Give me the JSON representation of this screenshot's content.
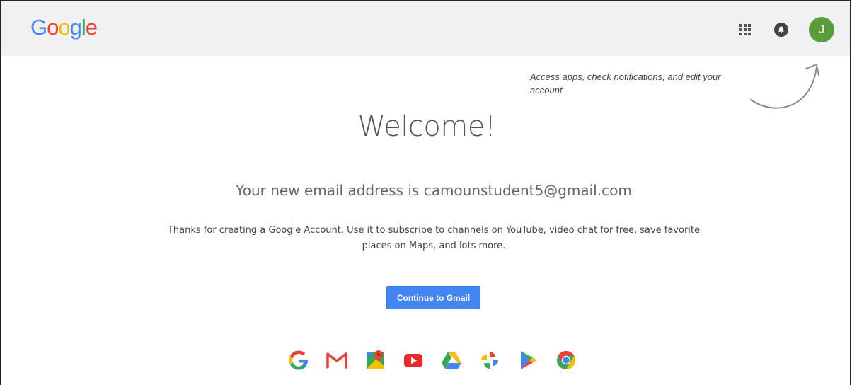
{
  "header": {
    "logo_text": [
      "G",
      "o",
      "o",
      "g",
      "l",
      "e"
    ],
    "avatar_initial": "J"
  },
  "hint": {
    "text": "Access apps, check notifications, and edit your account"
  },
  "main": {
    "welcome": "Welcome!",
    "email_line": "Your new email address is camounstudent5@gmail.com",
    "description": "Thanks for creating a Google Account. Use it to subscribe to channels on YouTube, video chat for free, save favorite places on Maps, and lots more.",
    "continue_button": "Continue to Gmail"
  },
  "apps": [
    {
      "icon": "google-icon"
    },
    {
      "icon": "gmail-icon"
    },
    {
      "icon": "maps-icon"
    },
    {
      "icon": "youtube-icon"
    },
    {
      "icon": "drive-icon"
    },
    {
      "icon": "photos-icon"
    },
    {
      "icon": "play-store-icon"
    },
    {
      "icon": "chrome-icon"
    }
  ],
  "colors": {
    "google_blue": "#4285F4",
    "google_red": "#EA4335",
    "google_yellow": "#FBBC05",
    "google_green": "#34A853",
    "avatar_green": "#5a9c3a",
    "header_bg": "#f1f1f1"
  }
}
